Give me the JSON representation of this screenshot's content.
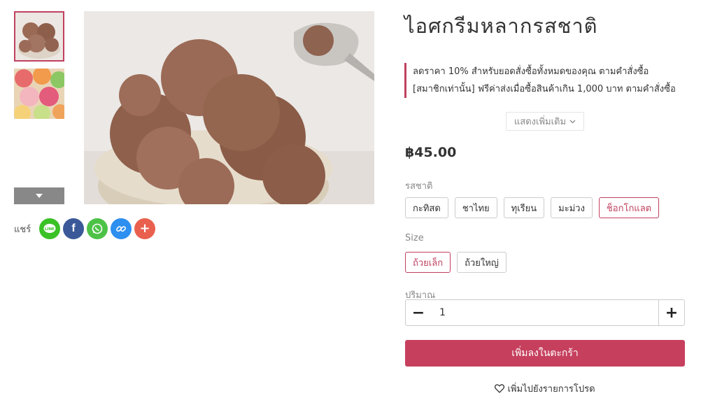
{
  "product": {
    "title": "ไอศกรีมหลากรสชาติ",
    "promotions": [
      "ลดราคา 10% สำหรับยอดสั่งซื้อทั้งหมดของคุณ ตามคำสั่งซื้อ",
      "[สมาชิกเท่านั้น] ฟรีค่าส่งเมื่อซื้อสินค้าเกิน 1,000 บาท ตามคำสั่งซื้อ"
    ],
    "show_more": "แสดงเพิ่มเติม",
    "price": "฿45.00"
  },
  "gallery": {
    "thumbnails": [
      "chocolate-ice-cream-thumb",
      "mixed-ice-cream-thumb"
    ],
    "main_image": "chocolate-ice-cream-bowl"
  },
  "share": {
    "label": "แชร์",
    "buttons": [
      {
        "name": "line",
        "color": "#3ac126"
      },
      {
        "name": "facebook",
        "color": "#3b5998"
      },
      {
        "name": "whatsapp",
        "color": "#4dc247"
      },
      {
        "name": "copy-link",
        "color": "#2d8ff0"
      },
      {
        "name": "more",
        "color": "#e9604f"
      }
    ]
  },
  "flavor": {
    "label": "รสชาติ",
    "options": [
      "กะทิสด",
      "ชาไทย",
      "ทุเรียน",
      "มะม่วง",
      "ช็อกโกแลต"
    ],
    "selected": "ช็อกโกแลต"
  },
  "size": {
    "label": "Size",
    "options": [
      "ถ้วยเล็ก",
      "ถ้วยใหญ่"
    ],
    "selected": "ถ้วยเล็ก"
  },
  "quantity": {
    "label": "ปริมาณ",
    "value": "1",
    "minus": "−",
    "plus": "+"
  },
  "actions": {
    "add_to_cart": "เพิ่มลงในตะกร้า",
    "wishlist": "เพิ่มไปยังรายการโปรด"
  },
  "colors": {
    "accent": "#c6405e"
  }
}
